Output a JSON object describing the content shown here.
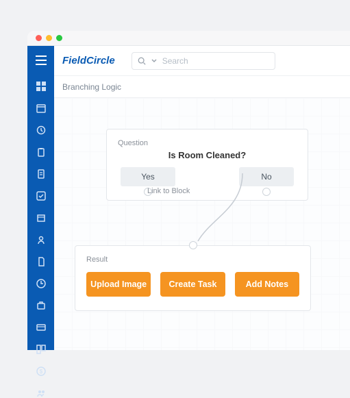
{
  "window": {
    "traffic_colors": {
      "close": "#ff5f57",
      "min": "#ffbd2e",
      "max": "#28c840"
    }
  },
  "brand": {
    "name": "FieldCircle",
    "accent": "#0a5bb3"
  },
  "search": {
    "placeholder": "Search"
  },
  "breadcrumb": "Branching Logic",
  "sidebar": {
    "icons": [
      "dashboard-icon",
      "calendar-icon",
      "history-icon",
      "clipboard-icon",
      "invoice-icon",
      "checklist-icon",
      "package-icon",
      "contacts-icon",
      "document-icon",
      "clock-icon",
      "briefcase-icon",
      "card-icon",
      "board-icon",
      "dollar-icon",
      "team-icon"
    ]
  },
  "question_node": {
    "label": "Question",
    "text": "Is Room Cleaned?",
    "options": [
      "Yes",
      "No"
    ]
  },
  "link_label": "Link to Block",
  "result_node": {
    "label": "Result",
    "actions": [
      "Upload Image",
      "Create Task",
      "Add Notes"
    ]
  },
  "colors": {
    "action_button": "#f59421",
    "sidebar": "#0a5bb3"
  }
}
